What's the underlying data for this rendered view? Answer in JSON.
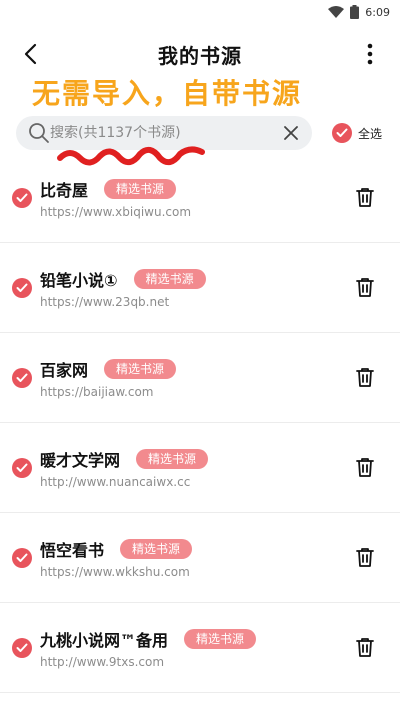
{
  "status_bar": {
    "time": "6:09"
  },
  "header": {
    "title": "我的书源"
  },
  "promo_text": "无需导入，自带书源",
  "search": {
    "placeholder": "搜索(共1137个书源)",
    "value": ""
  },
  "select_all_label": "全选",
  "colors": {
    "accent": "#e8545c",
    "tag": "#f28a8e",
    "promo": "#f7a51c"
  },
  "sources": [
    {
      "name": "比奇屋",
      "tag": "精选书源",
      "url": "https://www.xbiqiwu.com"
    },
    {
      "name": "铅笔小说①",
      "tag": "精选书源",
      "url": "https://www.23qb.net"
    },
    {
      "name": "百家网",
      "tag": "精选书源",
      "url": "https://baijiaw.com"
    },
    {
      "name": "暖才文学网",
      "tag": "精选书源",
      "url": "http://www.nuancaiwx.cc"
    },
    {
      "name": "悟空看书",
      "tag": "精选书源",
      "url": "https://www.wkkshu.com"
    },
    {
      "name": "九桃小说网™备用",
      "tag": "精选书源",
      "url": "http://www.9txs.com"
    }
  ]
}
